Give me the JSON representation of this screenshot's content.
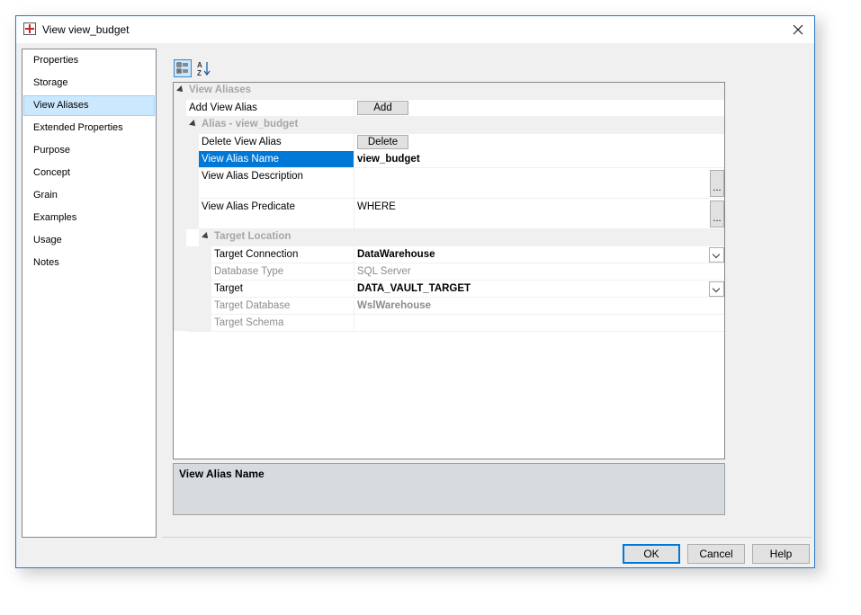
{
  "window": {
    "title": "View view_budget"
  },
  "nav": {
    "items": [
      {
        "label": "Properties"
      },
      {
        "label": "Storage"
      },
      {
        "label": "View Aliases"
      },
      {
        "label": "Extended Properties"
      },
      {
        "label": "Purpose"
      },
      {
        "label": "Concept"
      },
      {
        "label": "Grain"
      },
      {
        "label": "Examples"
      },
      {
        "label": "Usage"
      },
      {
        "label": "Notes"
      }
    ],
    "selected": "View Aliases"
  },
  "grid": {
    "category_view_aliases": "View Aliases",
    "add_view_alias": {
      "name": "Add View Alias",
      "button": "Add"
    },
    "category_alias": "Alias - view_budget",
    "delete_view_alias": {
      "name": "Delete View Alias",
      "button": "Delete"
    },
    "view_alias_name": {
      "name": "View Alias Name",
      "value": "view_budget"
    },
    "view_alias_description": {
      "name": "View Alias Description",
      "value": ""
    },
    "view_alias_predicate": {
      "name": "View Alias Predicate",
      "value": "WHERE"
    },
    "ellipsis": "...",
    "category_target_location": "Target Location",
    "target_connection": {
      "name": "Target Connection",
      "value": "DataWarehouse"
    },
    "database_type": {
      "name": "Database Type",
      "value": "SQL Server"
    },
    "target": {
      "name": "Target",
      "value": "DATA_VAULT_TARGET"
    },
    "target_database": {
      "name": "Target Database",
      "value": "WslWarehouse"
    },
    "target_schema": {
      "name": "Target Schema",
      "value": ""
    }
  },
  "description": {
    "title": "View Alias Name"
  },
  "buttons": {
    "ok": "OK",
    "cancel": "Cancel",
    "help": "Help"
  },
  "colors": {
    "selection": "#0078d7",
    "nav_selected": "#cce8ff",
    "category_text": "#a6a6a6"
  }
}
